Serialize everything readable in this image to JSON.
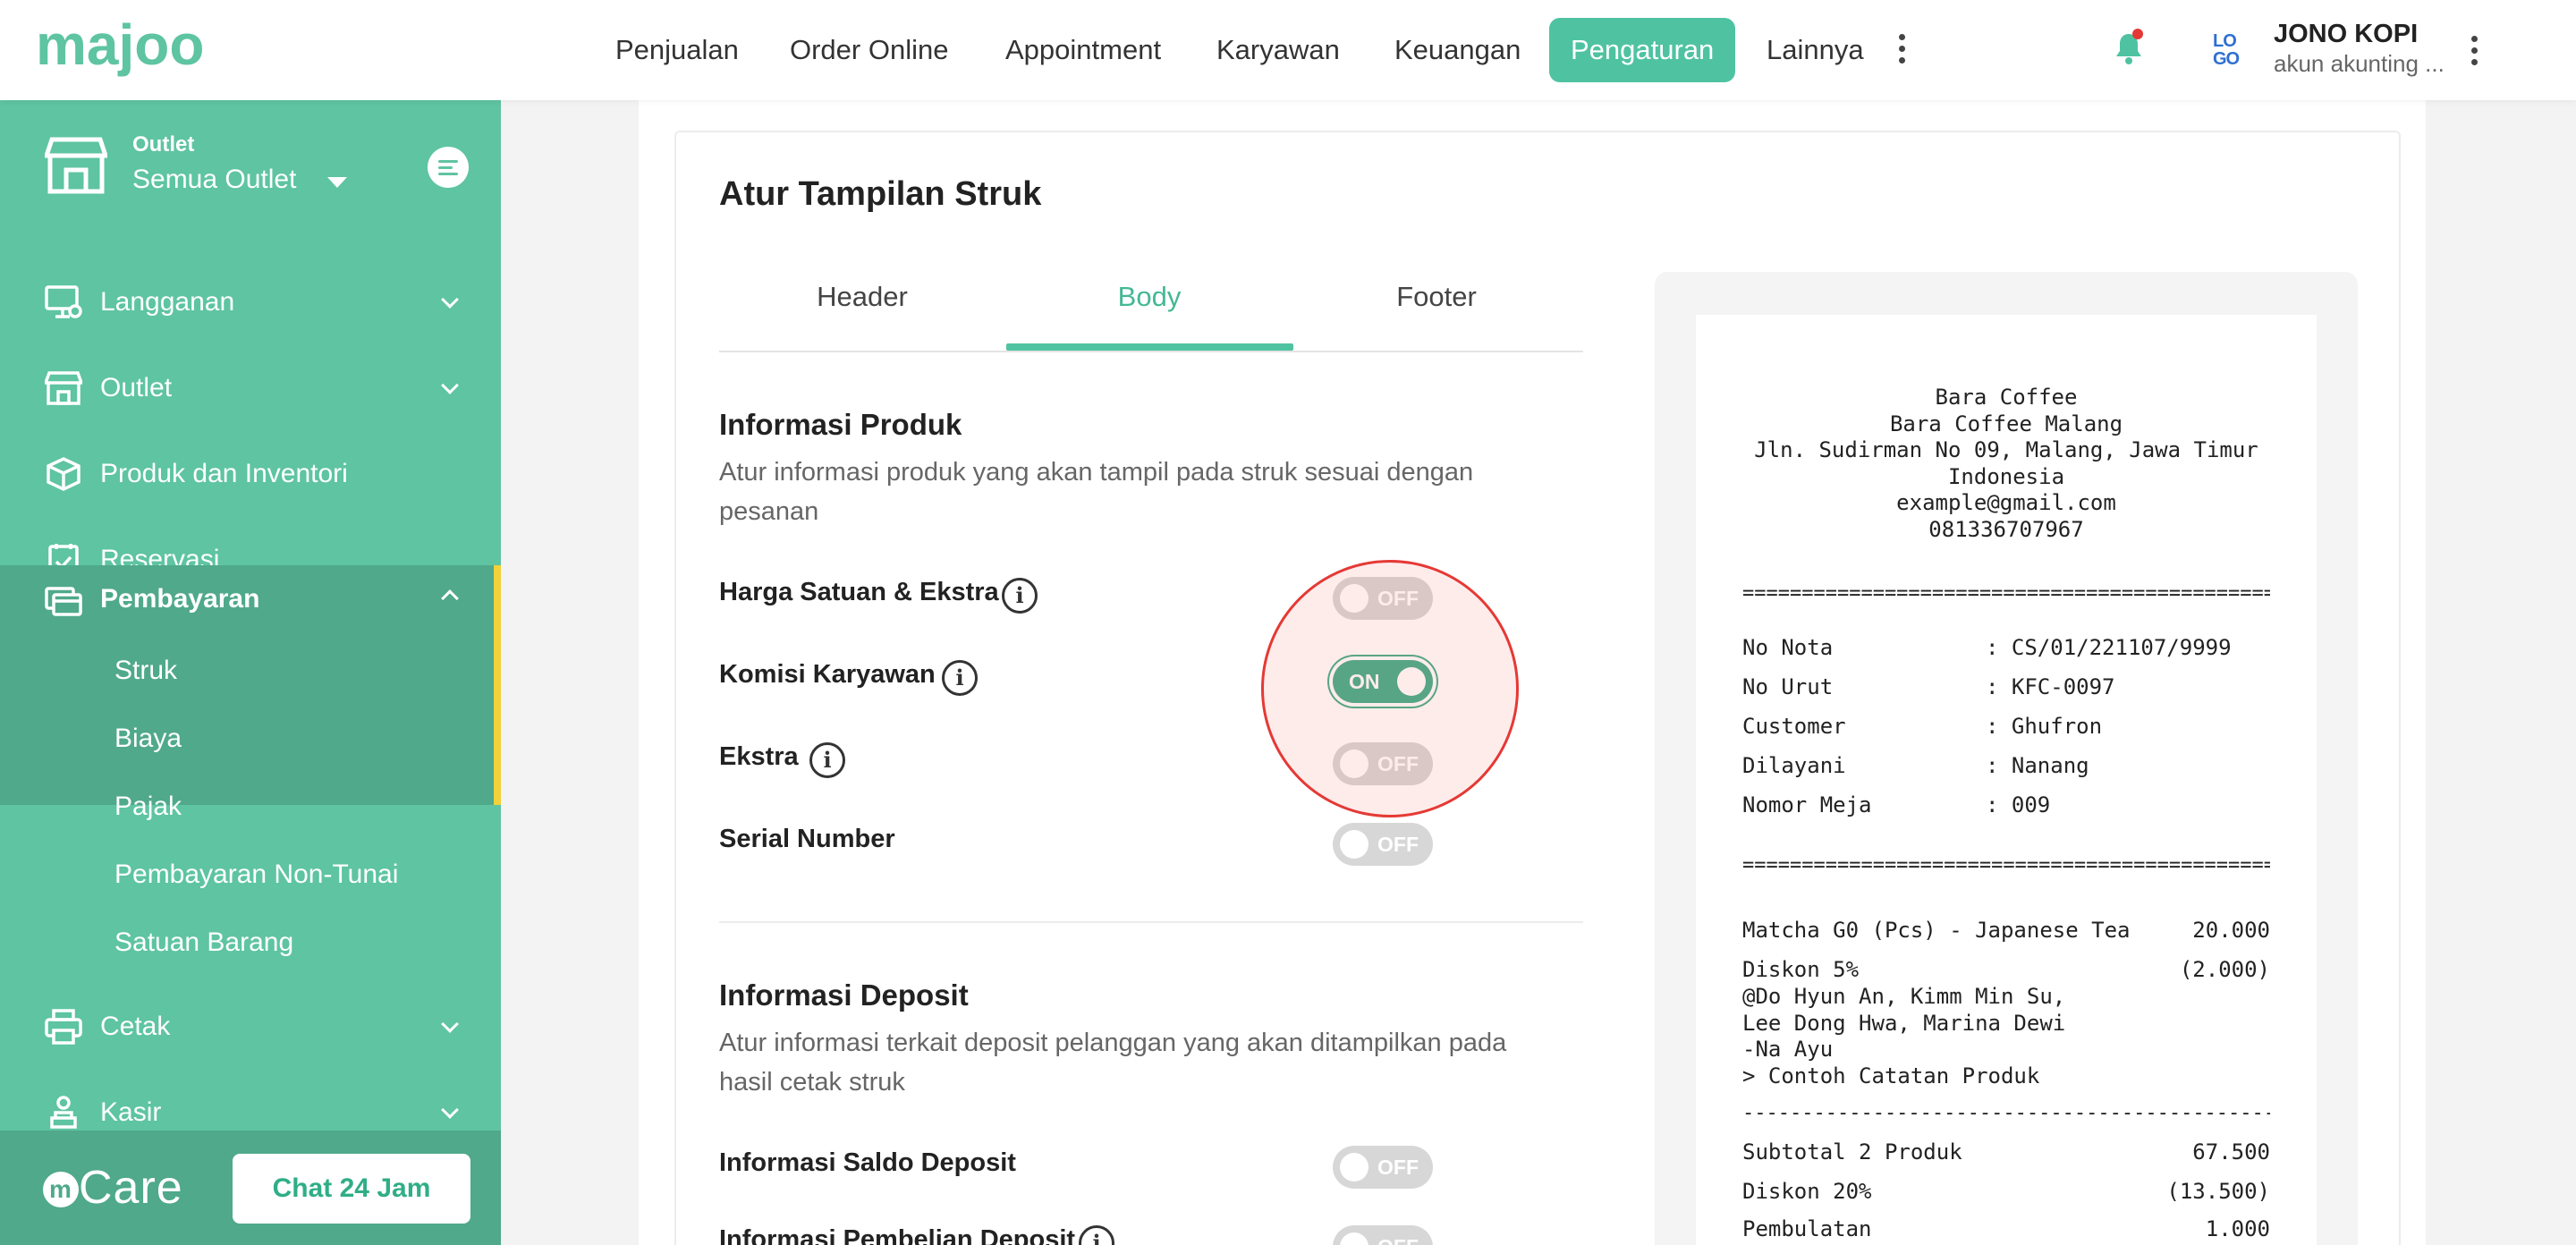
{
  "brand": {
    "logo_text": "majoo",
    "mini_logo": "LO GO"
  },
  "nav": {
    "items": [
      "Penjualan",
      "Order Online",
      "Appointment",
      "Karyawan",
      "Keuangan",
      "Pengaturan",
      "Lainnya"
    ],
    "active": "Pengaturan"
  },
  "user": {
    "name": "JONO KOPI",
    "subtitle": "akun akunting ..."
  },
  "sidebar": {
    "outlet_label": "Outlet",
    "outlet_value": "Semua Outlet",
    "items": [
      {
        "label": "Langganan",
        "icon": "monitor-gear-icon"
      },
      {
        "label": "Outlet",
        "icon": "store-icon"
      },
      {
        "label": "Produk dan Inventori",
        "icon": "box-icon"
      },
      {
        "label": "Reservasi",
        "icon": "calendar-check-icon"
      },
      {
        "label": "Pembayaran",
        "icon": "payment-icon"
      },
      {
        "label": "Cetak",
        "icon": "printer-icon"
      },
      {
        "label": "Kasir",
        "icon": "cashier-icon"
      }
    ],
    "pembayaran_sub": [
      "Struk",
      "Biaya",
      "Pajak",
      "Pembayaran Non-Tunai",
      "Satuan Barang"
    ],
    "active_sub": "Struk",
    "care_label": "Care",
    "chat_button": "Chat 24 Jam"
  },
  "page": {
    "title": "Atur Tampilan Struk",
    "tabs": [
      "Header",
      "Body",
      "Footer"
    ],
    "active_tab": "Body"
  },
  "produk": {
    "title": "Informasi Produk",
    "desc": "Atur informasi produk yang akan tampil pada struk sesuai dengan pesanan",
    "rows": [
      {
        "label": "Harga Satuan & Ekstra",
        "state": "OFF",
        "info": true
      },
      {
        "label": "Komisi Karyawan",
        "state": "ON",
        "info": true
      },
      {
        "label": "Ekstra",
        "state": "OFF",
        "info": true
      },
      {
        "label": "Serial Number",
        "state": "OFF",
        "info": false
      }
    ]
  },
  "deposit": {
    "title": "Informasi Deposit",
    "desc": "Atur informasi terkait deposit pelanggan yang akan ditampilkan pada hasil cetak struk",
    "rows": [
      {
        "label": "Informasi Saldo Deposit",
        "state": "OFF"
      },
      {
        "label": "Informasi Pembelian Deposit",
        "state": "OFF"
      }
    ]
  },
  "receipt": {
    "header_lines": [
      "Bara Coffee",
      "Bara Coffee Malang",
      "Jln. Sudirman No 09, Malang, Jawa Timur",
      "Indonesia",
      "example@gmail.com",
      "081336707967"
    ],
    "separator": "============================================================",
    "separator_single": "------------------------------------------------------------",
    "info": [
      {
        "key": "No Nota",
        "value": "CS/01/221107/9999"
      },
      {
        "key": "No Urut",
        "value": "KFC-0097"
      },
      {
        "key": "Customer",
        "value": "Ghufron"
      },
      {
        "key": "Dilayani",
        "value": "Nanang"
      },
      {
        "key": "Nomor Meja",
        "value": "009"
      }
    ],
    "item_name": "Matcha G0 (Pcs) - Japanese Tea",
    "item_price": "20.000",
    "item_discount_label": "Diskon 5%",
    "item_discount_value": "(2.000)",
    "commission_lines": [
      "@Do Hyun An, Kimm Min Su,",
      "Lee Dong Hwa, Marina Dewi",
      "-Na Ayu"
    ],
    "note": "> Contoh Catatan Produk",
    "totals": [
      {
        "key": "Subtotal 2 Produk",
        "value": "67.500"
      },
      {
        "key": "Diskon 20%",
        "value": "(13.500)"
      },
      {
        "key": "Pembulatan",
        "value": "1.000"
      }
    ]
  },
  "colors": {
    "accent": "#4fc3a1",
    "sidebar": "#5ec4a2",
    "sidebar_active": "#4fa98a",
    "indicator": "#f2d13a",
    "highlight": "#e53935"
  }
}
